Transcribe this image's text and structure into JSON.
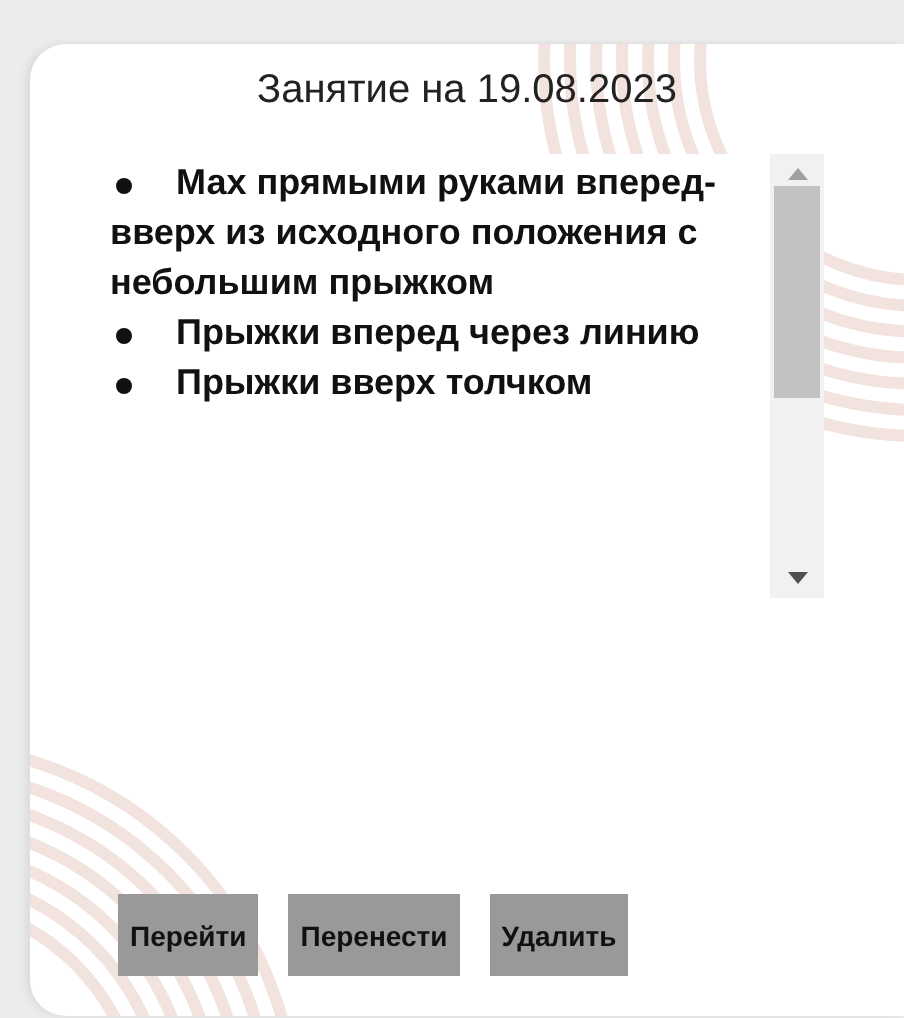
{
  "title": "Занятие на 19.08.2023",
  "exercises": [
    "Мах прямыми руками вперед-вверх из исходного положения с небольшим прыжком",
    "Прыжки вперед через линию",
    "Прыжки вверх толчком"
  ],
  "buttons": [
    "Перейти",
    "Перенести",
    "Удалить"
  ]
}
